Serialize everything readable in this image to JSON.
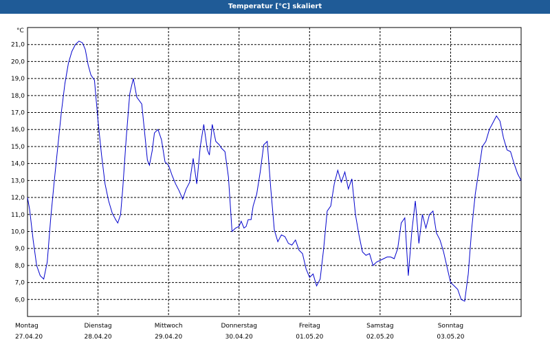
{
  "chart_data": {
    "type": "line",
    "title": "Temperatur [°C] skaliert",
    "ylabel": "°C",
    "ylim": [
      5.0,
      22.0
    ],
    "xlim": [
      0,
      7
    ],
    "grid": true,
    "colors": {
      "titlebar": "#1f5b97",
      "line": "#0000cc",
      "grid": "#000000"
    },
    "y_ticks": [
      "6,0",
      "7,0",
      "8,0",
      "9,0",
      "10,0",
      "11,0",
      "12,0",
      "13,0",
      "14,0",
      "15,0",
      "16,0",
      "17,0",
      "18,0",
      "19,0",
      "20,0",
      "21,0"
    ],
    "x_ticks": [
      {
        "day": "Montag",
        "date": "27.04.20"
      },
      {
        "day": "Dienstag",
        "date": "28.04.20"
      },
      {
        "day": "Mittwoch",
        "date": "29.04.20"
      },
      {
        "day": "Donnerstag",
        "date": "30.04.20"
      },
      {
        "day": "Freitag",
        "date": "01.05.20"
      },
      {
        "day": "Samstag",
        "date": "02.05.20"
      },
      {
        "day": "Sonntag",
        "date": "03.05.20"
      }
    ],
    "series": [
      {
        "x": [
          0,
          0.03,
          0.08,
          0.13,
          0.18,
          0.23,
          0.28,
          0.33,
          0.38,
          0.43,
          0.48,
          0.53,
          0.58,
          0.63,
          0.68,
          0.73,
          0.78,
          0.82,
          0.86,
          0.9,
          0.95,
          1.0,
          1.05,
          1.1,
          1.15,
          1.2,
          1.25,
          1.28,
          1.32,
          1.35,
          1.4,
          1.45,
          1.5,
          1.55,
          1.62,
          1.7,
          1.73,
          1.77,
          1.8,
          1.85,
          1.9,
          1.95,
          2.0,
          2.05,
          2.1,
          2.15,
          2.2,
          2.25,
          2.3,
          2.35,
          2.4,
          2.45,
          2.5,
          2.55,
          2.58,
          2.62,
          2.67,
          2.72,
          2.75,
          2.8,
          2.85,
          2.9,
          2.95,
          3.0,
          3.03,
          3.07,
          3.1,
          3.13,
          3.17,
          3.2,
          3.25,
          3.3,
          3.35,
          3.4,
          3.45,
          3.5,
          3.55,
          3.6,
          3.65,
          3.7,
          3.75,
          3.8,
          3.85,
          3.9,
          3.95,
          4.0,
          4.05,
          4.1,
          4.15,
          4.2,
          4.25,
          4.3,
          4.35,
          4.4,
          4.45,
          4.5,
          4.55,
          4.6,
          4.65,
          4.7,
          4.75,
          4.8,
          4.85,
          4.9,
          4.95,
          5.0,
          5.05,
          5.1,
          5.15,
          5.2,
          5.25,
          5.3,
          5.35,
          5.4,
          5.45,
          5.5,
          5.55,
          5.6,
          5.65,
          5.7,
          5.75,
          5.8,
          5.85,
          5.9,
          5.95,
          6.0,
          6.05,
          6.1,
          6.15,
          6.2,
          6.25,
          6.3,
          6.35,
          6.4,
          6.45,
          6.5,
          6.55,
          6.6,
          6.65,
          6.7,
          6.75,
          6.8,
          6.85,
          6.9,
          6.95,
          7.0
        ],
        "values": [
          12.0,
          11.3,
          9.5,
          8.0,
          7.4,
          7.2,
          8.2,
          10.8,
          13.0,
          15.0,
          17.0,
          18.7,
          19.9,
          20.6,
          21.0,
          21.2,
          21.1,
          20.7,
          19.8,
          19.2,
          18.9,
          16.5,
          14.5,
          12.8,
          11.8,
          11.1,
          10.7,
          10.5,
          11.0,
          12.5,
          15.5,
          18.1,
          19.0,
          17.9,
          17.5,
          14.2,
          13.9,
          14.8,
          15.8,
          16.0,
          15.4,
          14.1,
          13.9,
          13.3,
          12.8,
          12.4,
          11.9,
          12.5,
          12.9,
          14.3,
          12.8,
          15.0,
          16.3,
          14.8,
          14.5,
          16.3,
          15.3,
          15.1,
          14.9,
          14.7,
          13.2,
          10.0,
          10.2,
          10.3,
          10.6,
          10.2,
          10.3,
          10.7,
          10.7,
          11.5,
          12.2,
          13.5,
          15.1,
          15.3,
          12.5,
          10.1,
          9.4,
          9.8,
          9.7,
          9.3,
          9.2,
          9.5,
          8.9,
          8.7,
          7.8,
          7.3,
          7.5,
          6.8,
          7.2,
          9.0,
          11.2,
          11.5,
          12.8,
          13.6,
          12.9,
          13.5,
          12.5,
          13.1,
          11.0,
          9.8,
          8.8,
          8.6,
          8.7,
          8.0,
          8.2,
          8.3,
          8.4,
          8.5,
          8.5,
          8.4,
          9.0,
          10.5,
          10.8,
          7.4,
          10.0,
          11.8,
          9.3,
          11.0,
          10.2,
          11.0,
          11.2,
          9.9,
          9.5,
          8.8,
          7.9,
          7.0,
          6.8,
          6.6,
          6.0,
          5.9,
          7.5,
          10.2,
          12.2,
          13.6,
          15.0,
          15.3,
          16.0,
          16.4,
          16.8,
          16.5,
          15.5,
          14.8,
          14.7,
          14.0,
          13.4,
          13.0
        ]
      }
    ]
  }
}
